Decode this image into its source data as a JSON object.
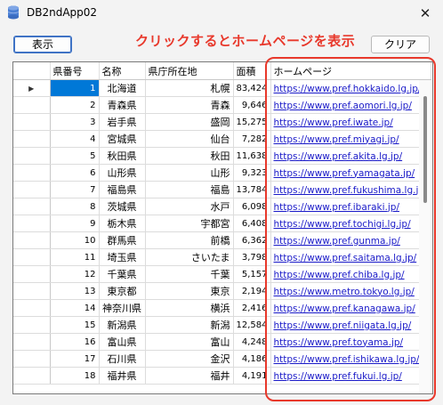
{
  "window": {
    "title": "DB2ndApp02",
    "close_glyph": "✕",
    "app_icon": "database-icon"
  },
  "toolbar": {
    "show_label": "表示",
    "clear_label": "クリア"
  },
  "annotation": {
    "text": "クリックするとホームページを表示",
    "color": "#e8382b"
  },
  "grid": {
    "columns": [
      "県番号",
      "名称",
      "県庁所在地",
      "面積",
      "ホームページ"
    ],
    "current_row_marker": "▶",
    "rows": [
      [
        "1",
        "北海道",
        "札幌",
        "83,424",
        "https://www.pref.hokkaido.lg.jp/"
      ],
      [
        "2",
        "青森県",
        "青森",
        "9,646",
        "https://www.pref.aomori.lg.jp/"
      ],
      [
        "3",
        "岩手県",
        "盛岡",
        "15,275",
        "https://www.pref.iwate.jp/"
      ],
      [
        "4",
        "宮城県",
        "仙台",
        "7,282",
        "https://www.pref.miyagi.jp/"
      ],
      [
        "5",
        "秋田県",
        "秋田",
        "11,638",
        "https://www.pref.akita.lg.jp/"
      ],
      [
        "6",
        "山形県",
        "山形",
        "9,323",
        "https://www.pref.yamagata.jp/"
      ],
      [
        "7",
        "福島県",
        "福島",
        "13,784",
        "https://www.pref.fukushima.lg.jp/"
      ],
      [
        "8",
        "茨城県",
        "水戸",
        "6,098",
        "https://www.pref.ibaraki.jp/"
      ],
      [
        "9",
        "栃木県",
        "宇都宮",
        "6,408",
        "https://www.pref.tochigi.lg.jp/"
      ],
      [
        "10",
        "群馬県",
        "前橋",
        "6,362",
        "https://www.pref.gunma.jp/"
      ],
      [
        "11",
        "埼玉県",
        "さいたま",
        "3,798",
        "https://www.pref.saitama.lg.jp/"
      ],
      [
        "12",
        "千葉県",
        "千葉",
        "5,157",
        "https://www.pref.chiba.lg.jp/"
      ],
      [
        "13",
        "東京都",
        "東京",
        "2,194",
        "https://www.metro.tokyo.lg.jp/"
      ],
      [
        "14",
        "神奈川県",
        "横浜",
        "2,416",
        "https://www.pref.kanagawa.jp/"
      ],
      [
        "15",
        "新潟県",
        "新潟",
        "12,584",
        "https://www.pref.niigata.lg.jp/"
      ],
      [
        "16",
        "富山県",
        "富山",
        "4,248",
        "https://www.pref.toyama.jp/"
      ],
      [
        "17",
        "石川県",
        "金沢",
        "4,186",
        "https://www.pref.ishikawa.lg.jp/"
      ],
      [
        "18",
        "福井県",
        "福井",
        "4,191",
        "https://www.pref.fukui.lg.jp/"
      ]
    ]
  },
  "colors": {
    "selection": "#0078d7",
    "link": "#1a1ac8",
    "highlight_box": "#e8382b"
  }
}
